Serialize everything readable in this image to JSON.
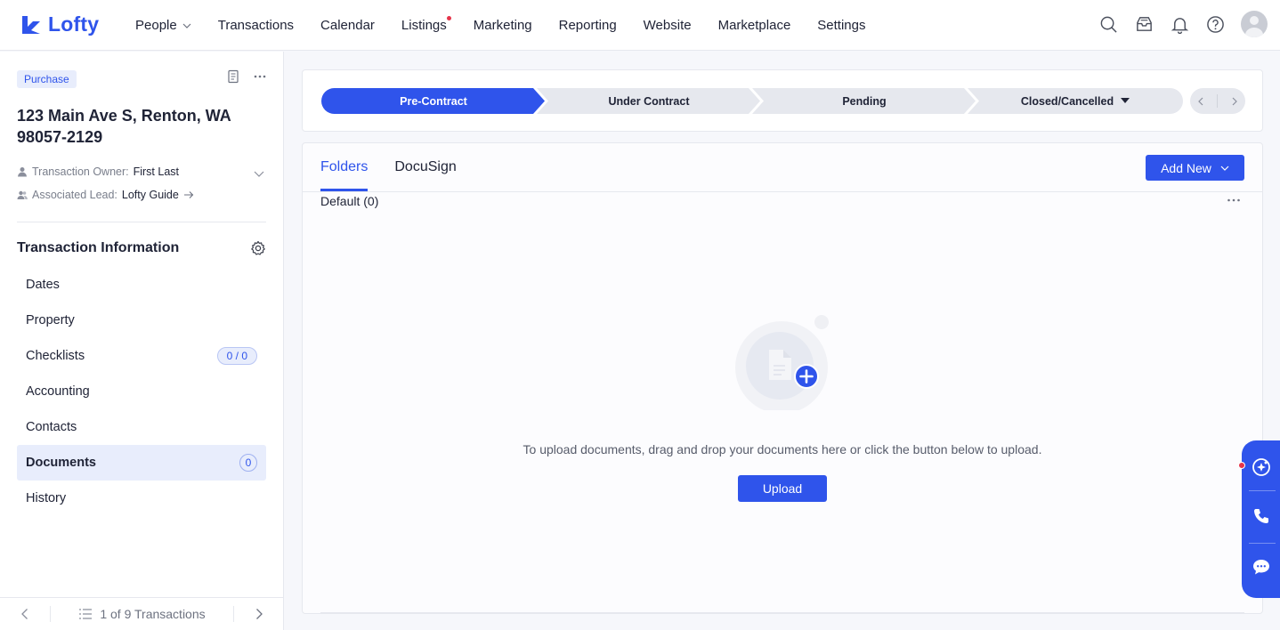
{
  "brand": {
    "name": "Lofty",
    "accent": "#2f54eb",
    "alert": "#e5344a"
  },
  "nav": {
    "items": [
      {
        "label": "People",
        "has_dropdown": true
      },
      {
        "label": "Transactions"
      },
      {
        "label": "Calendar"
      },
      {
        "label": "Listings",
        "has_dot": true
      },
      {
        "label": "Marketing"
      },
      {
        "label": "Reporting"
      },
      {
        "label": "Website"
      },
      {
        "label": "Marketplace"
      },
      {
        "label": "Settings"
      }
    ],
    "icons": [
      "search-icon",
      "inbox-icon",
      "bell-icon",
      "help-icon",
      "avatar"
    ]
  },
  "sidebar": {
    "tag": "Purchase",
    "address": "123 Main Ave S, Renton, WA 98057-2129",
    "owner_label": "Transaction Owner:",
    "owner_value": "First Last",
    "lead_label": "Associated Lead:",
    "lead_value": "Lofty Guide",
    "section_title": "Transaction Information",
    "items": [
      {
        "label": "Dates"
      },
      {
        "label": "Property"
      },
      {
        "label": "Checklists",
        "badge": "0 / 0"
      },
      {
        "label": "Accounting"
      },
      {
        "label": "Contacts"
      },
      {
        "label": "Documents",
        "badge": "0",
        "active": true
      },
      {
        "label": "History"
      }
    ],
    "footer": {
      "pager": "1 of 9 Transactions"
    }
  },
  "stages": {
    "items": [
      {
        "label": "Pre-Contract",
        "active": true
      },
      {
        "label": "Under Contract"
      },
      {
        "label": "Pending"
      },
      {
        "label": "Closed/Cancelled",
        "has_dropdown": true
      }
    ]
  },
  "documents": {
    "tabs": [
      {
        "label": "Folders",
        "active": true
      },
      {
        "label": "DocuSign"
      }
    ],
    "add_new_label": "Add New",
    "folder_label": "Default (0)",
    "empty_text": "To upload documents, drag and drop your documents here or click the button below to upload.",
    "upload_label": "Upload"
  },
  "widget": {
    "icons": [
      "assistant-icon",
      "phone-icon",
      "chat-icon"
    ]
  }
}
